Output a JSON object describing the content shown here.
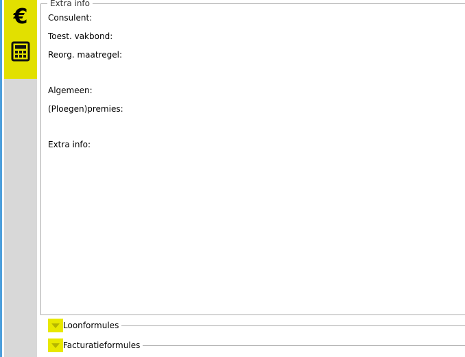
{
  "rail": {
    "euro_glyph": "€",
    "euro_icon": "euro-icon",
    "calculator_icon": "calculator-icon",
    "active_color": "#e2e000"
  },
  "extra_info": {
    "legend": "Extra info",
    "fields": {
      "consulent": "Consulent:",
      "vakbond": "Toest. vakbond:",
      "maatregel": "Reorg. maatregel:",
      "algemeen": "Algemeen:",
      "premies": "(Ploegen)premies:",
      "extra": "Extra info:"
    }
  },
  "sections": {
    "loonformules": "Loonformules",
    "facturatieformules": "Facturatieformules"
  }
}
